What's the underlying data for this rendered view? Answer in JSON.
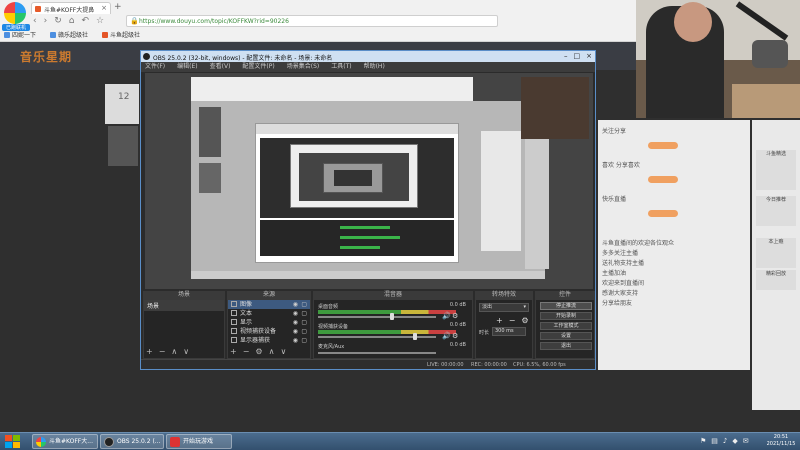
{
  "browser": {
    "badge": "已跑联机",
    "tab_title": "斗鱼#KOFF大提鼻",
    "url": "https://www.douyu.com/topic/KOFFKW?rid=90226",
    "bookmarks": [
      "四妮一下",
      "赣乐超级社",
      "斗鱼超级社"
    ]
  },
  "site": {
    "logo_text": "音乐星期",
    "card_num": "12",
    "chat_lines": [
      "关注分享",
      "喜欢 分享喜欢",
      "快乐直播",
      "斗鱼直播间的欢迎各位观众",
      "多多关注主播",
      "送礼物支持主播",
      "主播加油",
      "欢迎来到直播间",
      "感谢大家支持",
      "分享给朋友"
    ],
    "rail_labels": [
      "斗鱼精选",
      "今日推荐",
      "本上瘾",
      "精彩回放"
    ]
  },
  "obs": {
    "title": "OBS 25.0.2 (32-bit, windows) - 配置文件: 未命名 - 场景: 未命名",
    "menu": [
      "文件(F)",
      "编辑(E)",
      "查看(V)",
      "配置文件(P)",
      "场景集合(S)",
      "工具(T)",
      "帮助(H)"
    ],
    "docks": {
      "scenes": "场景",
      "sources": "来源",
      "mixer": "混音器",
      "transitions": "转场特效",
      "controls": "控件"
    },
    "scenes": [
      "场景"
    ],
    "sources": [
      {
        "name": "图像",
        "selected": true
      },
      {
        "name": "文本",
        "selected": false
      },
      {
        "name": "显示",
        "selected": false
      },
      {
        "name": "视频捕获设备",
        "selected": false
      },
      {
        "name": "显示器捕获",
        "selected": false
      }
    ],
    "mixer": [
      {
        "name": "桌面音频",
        "db": "0.0 dB",
        "level": 0.62
      },
      {
        "name": "视频捕获设备",
        "db": "0.0 dB",
        "level": 0.82
      },
      {
        "name": "麦克风/Aux",
        "db": "0.0 dB",
        "level": 0.0
      }
    ],
    "transition": {
      "type": "淡出",
      "duration_label": "时长",
      "duration": "300 ms"
    },
    "controls": [
      "停止推流",
      "开始录制",
      "工作室模式",
      "设置",
      "退出"
    ],
    "status": {
      "live": "LIVE: 00:00:00",
      "rec": "REC: 00:00:00",
      "cpu": "CPU: 6.5%, 60.00 fps"
    }
  },
  "taskbar": {
    "buttons": [
      "斗鱼#KOFF大...",
      "OBS 25.0.2 (...",
      "开始玩游戏"
    ],
    "time": "20:51",
    "date": "2021/11/15"
  },
  "colors": {
    "accent": "#5a8ec8",
    "live_green": "#3bb54a",
    "douyu_orange": "#f08a2a"
  }
}
